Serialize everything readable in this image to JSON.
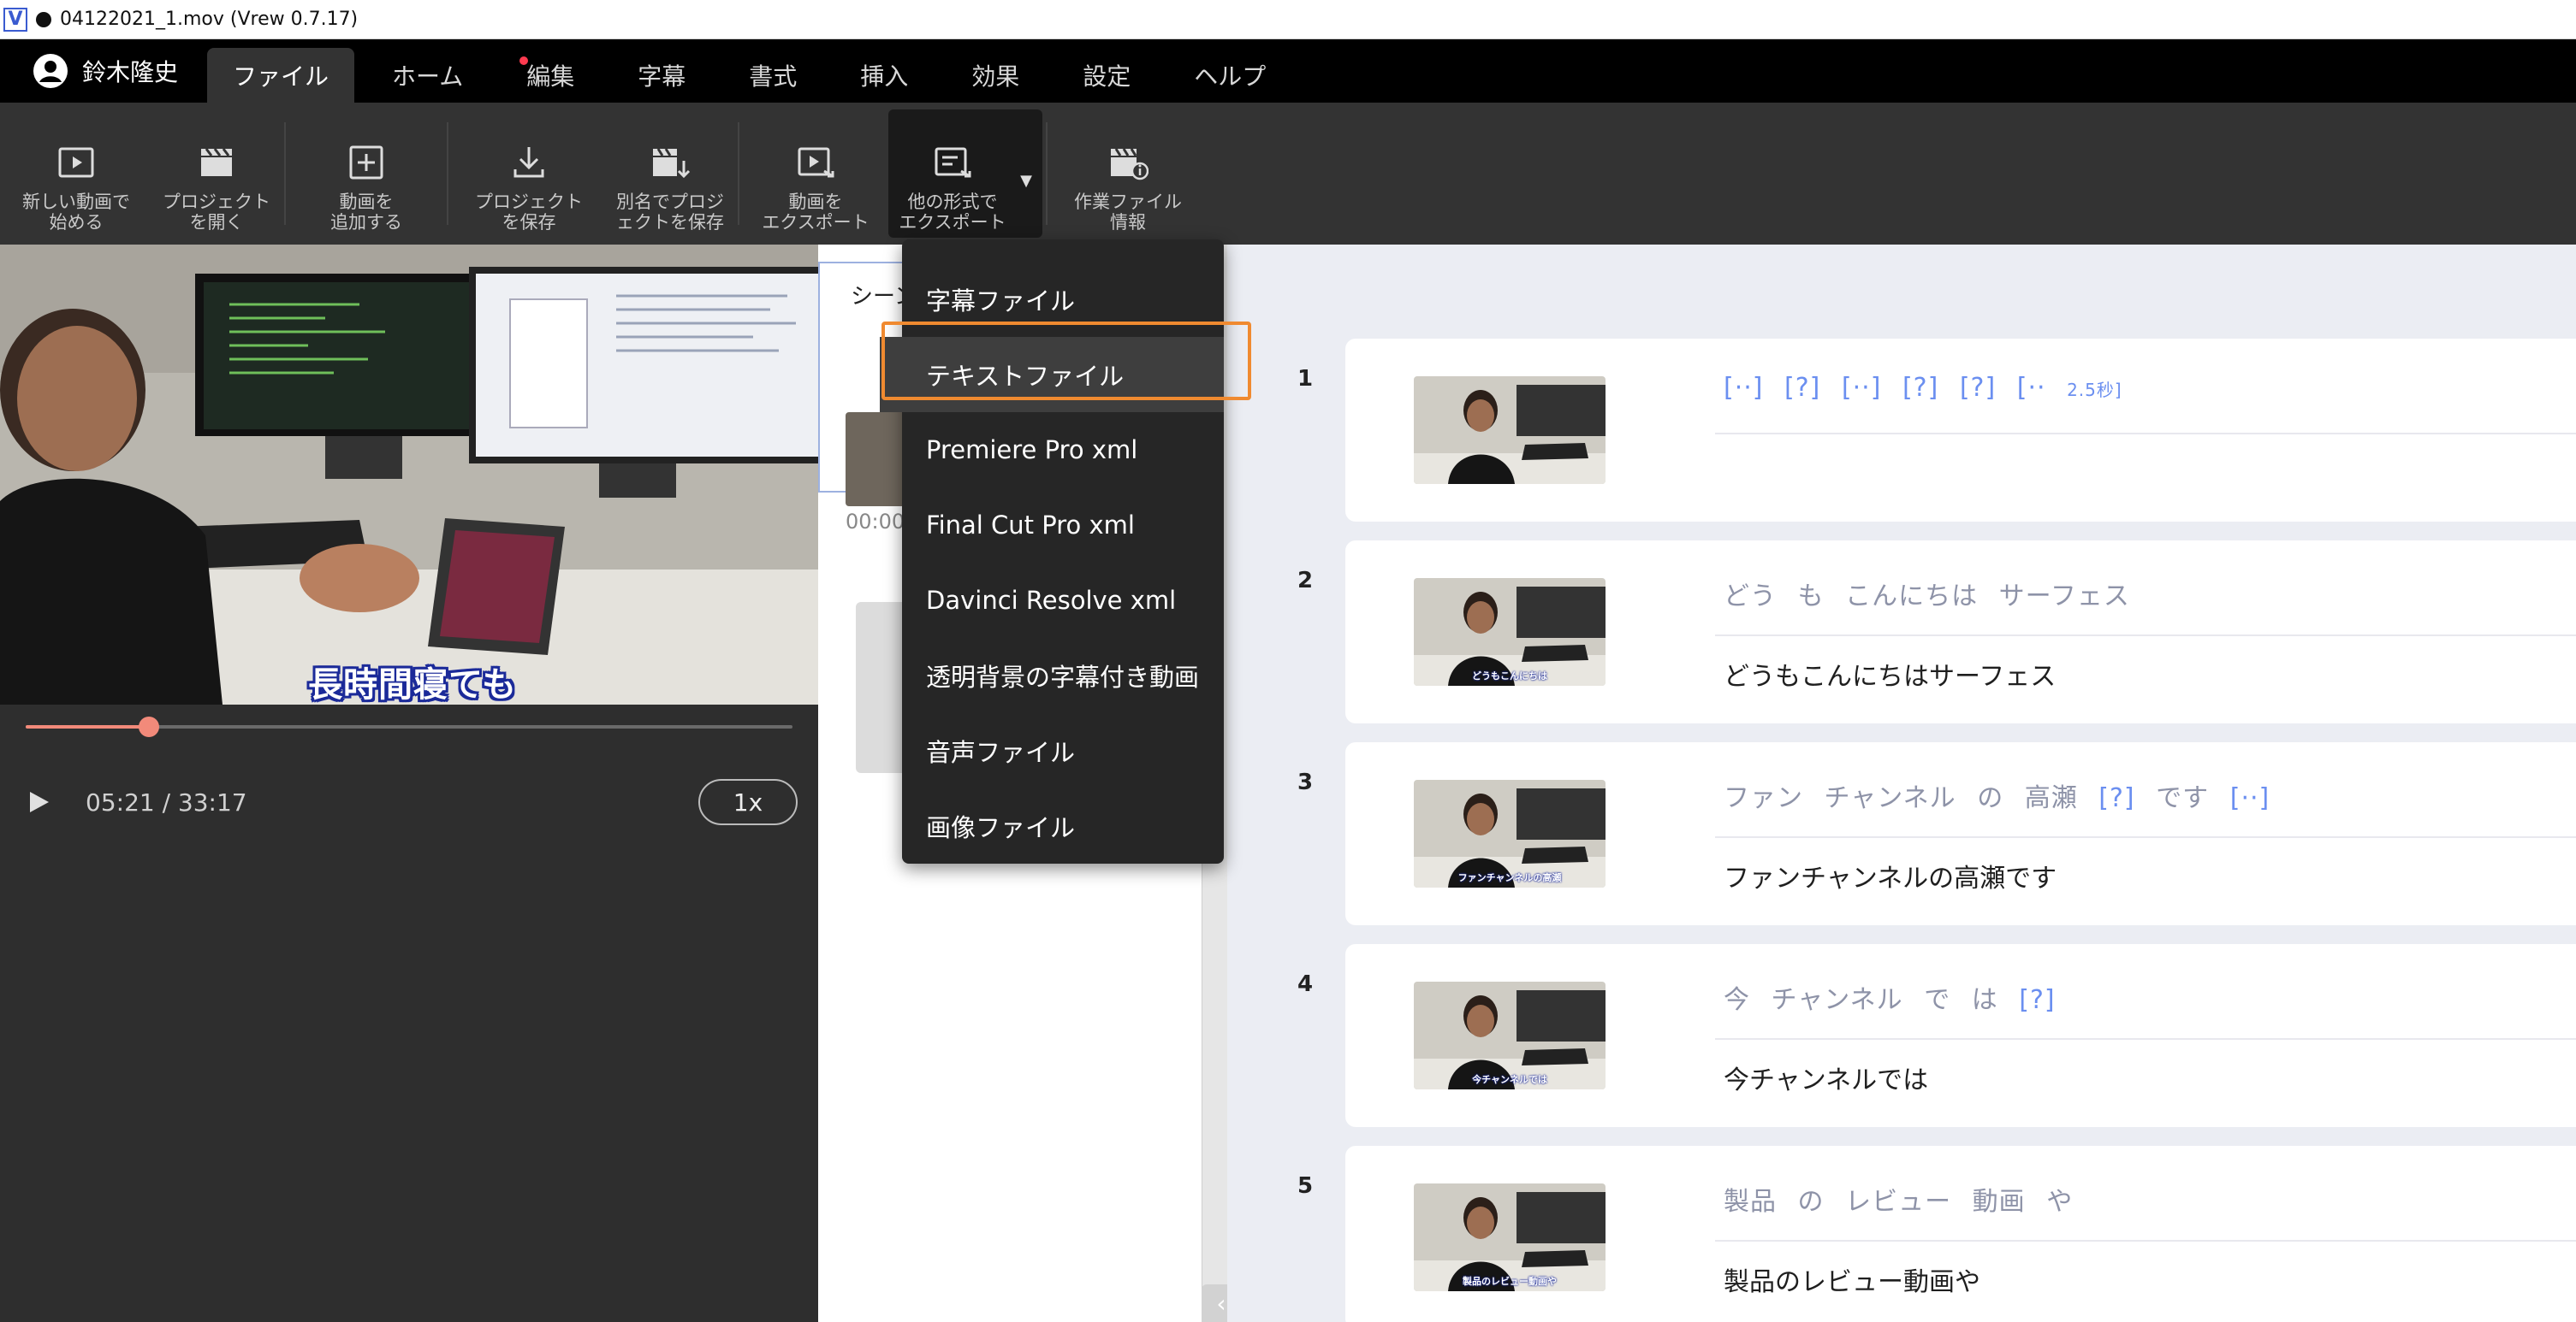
{
  "window": {
    "title": "04122021_1.mov (Vrew 0.7.17)",
    "logo_letter": "V"
  },
  "menubar": {
    "user_name": "鈴木隆史",
    "tabs": [
      {
        "label": "ファイル",
        "active": true
      },
      {
        "label": "ホーム"
      },
      {
        "label": "編集",
        "has_dot": true
      },
      {
        "label": "字幕"
      },
      {
        "label": "書式"
      },
      {
        "label": "挿入"
      },
      {
        "label": "効果"
      },
      {
        "label": "設定"
      },
      {
        "label": "ヘルプ"
      }
    ]
  },
  "toolbar": {
    "new_video": "新しい動画で\n始める",
    "open_project": "プロジェクト\nを開く",
    "add_video": "動画を\n追加する",
    "save_project": "プロジェクト\nを保存",
    "save_as": "別名でプロジ\nェクトを保存",
    "export_video": "動画を\nエクスポート",
    "export_other": "他の形式で\nエクスポート",
    "file_info": "作業ファイル\n情報"
  },
  "player": {
    "caption": "長時間寝ても",
    "time": "05:21 / 33:17",
    "speed": "1x",
    "progress": 0.161
  },
  "scene": {
    "label": "シーン",
    "time": "00:00"
  },
  "dropdown": {
    "items": [
      "字幕ファイル",
      "テキストファイル",
      "Premiere Pro xml",
      "Final Cut Pro xml",
      "Davinci Resolve xml",
      "透明背景の字幕付き動画",
      "音声ファイル",
      "画像ファイル"
    ],
    "highlighted_index": 1
  },
  "clips": [
    {
      "num": "1",
      "words": [
        "[··]",
        "[?]",
        "[··]",
        "[?]",
        "[?]",
        "[··"
      ],
      "words_tail": "2.5秒]",
      "text": "",
      "thumb_caption": ""
    },
    {
      "num": "2",
      "words": [
        "どう",
        "も",
        "こんにちは",
        "サーフェス"
      ],
      "text": "どうもこんにちはサーフェス",
      "thumb_caption": "どうもこんにちは"
    },
    {
      "num": "3",
      "words": [
        "ファン",
        "チャンネル",
        "の",
        "高瀬",
        "[?]",
        "です",
        "[··]"
      ],
      "text": "ファンチャンネルの高瀬です",
      "thumb_caption": "ファンチャンネルの高瀬"
    },
    {
      "num": "4",
      "words": [
        "今",
        "チャンネル",
        "で",
        "は",
        "[?]"
      ],
      "text": "今チャンネルでは",
      "thumb_caption": "今チャンネルでは"
    },
    {
      "num": "5",
      "words": [
        "製品",
        "の",
        "レビュー",
        "動画",
        "や"
      ],
      "text": "製品のレビュー動画や",
      "thumb_caption": "製品のレビュー動画や"
    }
  ],
  "colors": {
    "accent_orange": "#f08a30",
    "seek": "#f28a7a",
    "bracket_blue": "#6b8ff0"
  }
}
